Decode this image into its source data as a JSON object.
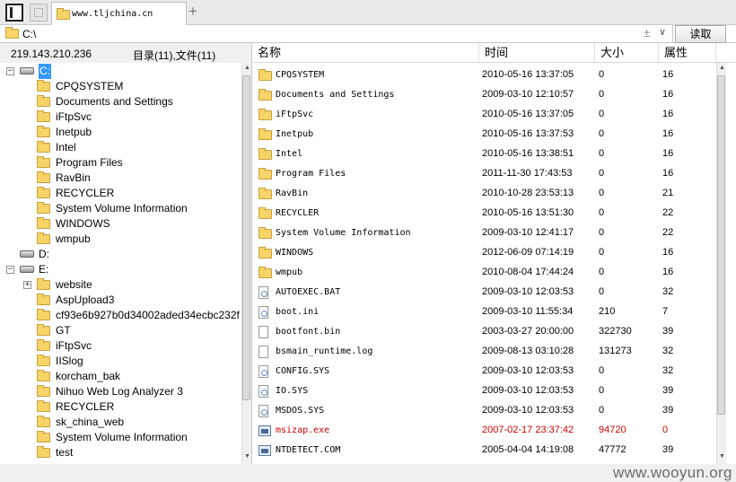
{
  "tab": {
    "title": "www.tljchina.cn"
  },
  "address": {
    "path": "C:\\",
    "read_button": "读取"
  },
  "info": {
    "ip": "219.143.210.236",
    "summary": "目录(11),文件(11)"
  },
  "tree": {
    "c_drive": "C:",
    "c_children": [
      "CPQSYSTEM",
      "Documents and Settings",
      "iFtpSvc",
      "Inetpub",
      "Intel",
      "Program Files",
      "RavBin",
      "RECYCLER",
      "System Volume Information",
      "WINDOWS",
      "wmpub"
    ],
    "d_drive": "D:",
    "e_drive": "E:",
    "e_children": [
      "website",
      "AspUpload3",
      "cf93e6b927b0d34002aded34ecbc232f",
      "GT",
      "iFtpSvc",
      "IISlog",
      "korcham_bak",
      "Nihuo Web Log Analyzer 3",
      "RECYCLER",
      "sk_china_web",
      "System Volume Information",
      "test"
    ]
  },
  "columns": {
    "name": "名称",
    "time": "时间",
    "size": "大小",
    "attr": "属性"
  },
  "files": [
    {
      "name": "CPQSYSTEM",
      "time": "2010-05-16 13:37:05",
      "size": "0",
      "attr": "16",
      "type": "folder-icon"
    },
    {
      "name": "Documents and Settings",
      "time": "2009-03-10 12:10:57",
      "size": "0",
      "attr": "16",
      "type": "folder-icon"
    },
    {
      "name": "iFtpSvc",
      "time": "2010-05-16 13:37:05",
      "size": "0",
      "attr": "16",
      "type": "folder-icon"
    },
    {
      "name": "Inetpub",
      "time": "2010-05-16 13:37:53",
      "size": "0",
      "attr": "16",
      "type": "folder-icon"
    },
    {
      "name": "Intel",
      "time": "2010-05-16 13:38:51",
      "size": "0",
      "attr": "16",
      "type": "folder-icon"
    },
    {
      "name": "Program Files",
      "time": "2011-11-30 17:43:53",
      "size": "0",
      "attr": "16",
      "type": "folder-icon"
    },
    {
      "name": "RavBin",
      "time": "2010-10-28 23:53:13",
      "size": "0",
      "attr": "21",
      "type": "folder-icon"
    },
    {
      "name": "RECYCLER",
      "time": "2010-05-16 13:51:30",
      "size": "0",
      "attr": "22",
      "type": "folder-icon"
    },
    {
      "name": "System Volume Information",
      "time": "2009-03-10 12:41:17",
      "size": "0",
      "attr": "22",
      "type": "folder-icon"
    },
    {
      "name": "WINDOWS",
      "time": "2012-06-09 07:14:19",
      "size": "0",
      "attr": "16",
      "type": "folder-icon"
    },
    {
      "name": "wmpub",
      "time": "2010-08-04 17:44:24",
      "size": "0",
      "attr": "16",
      "type": "folder-icon"
    },
    {
      "name": "AUTOEXEC.BAT",
      "time": "2009-03-10 12:03:53",
      "size": "0",
      "attr": "32",
      "type": "system-file-icon"
    },
    {
      "name": "boot.ini",
      "time": "2009-03-10 11:55:34",
      "size": "210",
      "attr": "7",
      "type": "ini-file-icon"
    },
    {
      "name": "bootfont.bin",
      "time": "2003-03-27 20:00:00",
      "size": "322730",
      "attr": "39",
      "type": "file-icon"
    },
    {
      "name": "bsmain_runtime.log",
      "time": "2009-08-13 03:10:28",
      "size": "131273",
      "attr": "32",
      "type": "file-icon"
    },
    {
      "name": "CONFIG.SYS",
      "time": "2009-03-10 12:03:53",
      "size": "0",
      "attr": "32",
      "type": "system-file-icon"
    },
    {
      "name": "IO.SYS",
      "time": "2009-03-10 12:03:53",
      "size": "0",
      "attr": "39",
      "type": "system-file-icon"
    },
    {
      "name": "MSDOS.SYS",
      "time": "2009-03-10 12:03:53",
      "size": "0",
      "attr": "39",
      "type": "system-file-icon"
    },
    {
      "name": "msizap.exe",
      "time": "2007-02-17 23:37:42",
      "size": "94720",
      "attr": "0",
      "type": "exe-file-icon",
      "color": "#d00000"
    },
    {
      "name": "NTDETECT.COM",
      "time": "2005-04-04 14:19:08",
      "size": "47772",
      "attr": "39",
      "type": "exe-file-icon"
    }
  ],
  "watermark": "www.wooyun.org",
  "colors": {
    "selection": "#3399ff",
    "folder": "#f7d467",
    "highlight_red": "#d00000"
  }
}
